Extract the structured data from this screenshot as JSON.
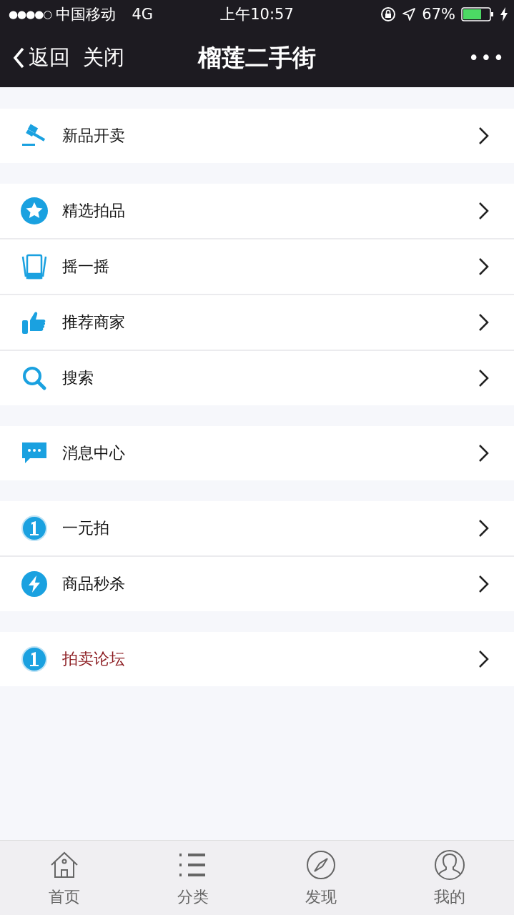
{
  "status_bar": {
    "signal": "●●●●○",
    "carrier": "中国移动",
    "network": "4G",
    "time": "上午10:57",
    "battery": "67%"
  },
  "nav": {
    "back": "返回",
    "close": "关闭",
    "title": "榴莲二手街",
    "more": "•••"
  },
  "sections": [
    {
      "items": [
        {
          "kind": "gavel",
          "label": "新品开卖",
          "highlighted": false
        }
      ]
    },
    {
      "items": [
        {
          "kind": "star",
          "label": "精选拍品",
          "highlighted": false
        },
        {
          "kind": "phone",
          "label": "摇一摇",
          "highlighted": false
        },
        {
          "kind": "thumb",
          "label": "推荐商家",
          "highlighted": false
        },
        {
          "kind": "search",
          "label": "搜索",
          "highlighted": false
        }
      ]
    },
    {
      "items": [
        {
          "kind": "chat",
          "label": "消息中心",
          "highlighted": false
        }
      ]
    },
    {
      "items": [
        {
          "kind": "one",
          "label": "一元拍",
          "highlighted": false
        },
        {
          "kind": "bolt",
          "label": "商品秒杀",
          "highlighted": false
        }
      ]
    },
    {
      "items": [
        {
          "kind": "one",
          "label": "拍卖论坛",
          "highlighted": true
        }
      ]
    }
  ],
  "tab_bar": [
    {
      "kind": "home",
      "label": "首页"
    },
    {
      "kind": "list",
      "label": "分类"
    },
    {
      "kind": "compass",
      "label": "发现"
    },
    {
      "kind": "user",
      "label": "我的"
    }
  ]
}
